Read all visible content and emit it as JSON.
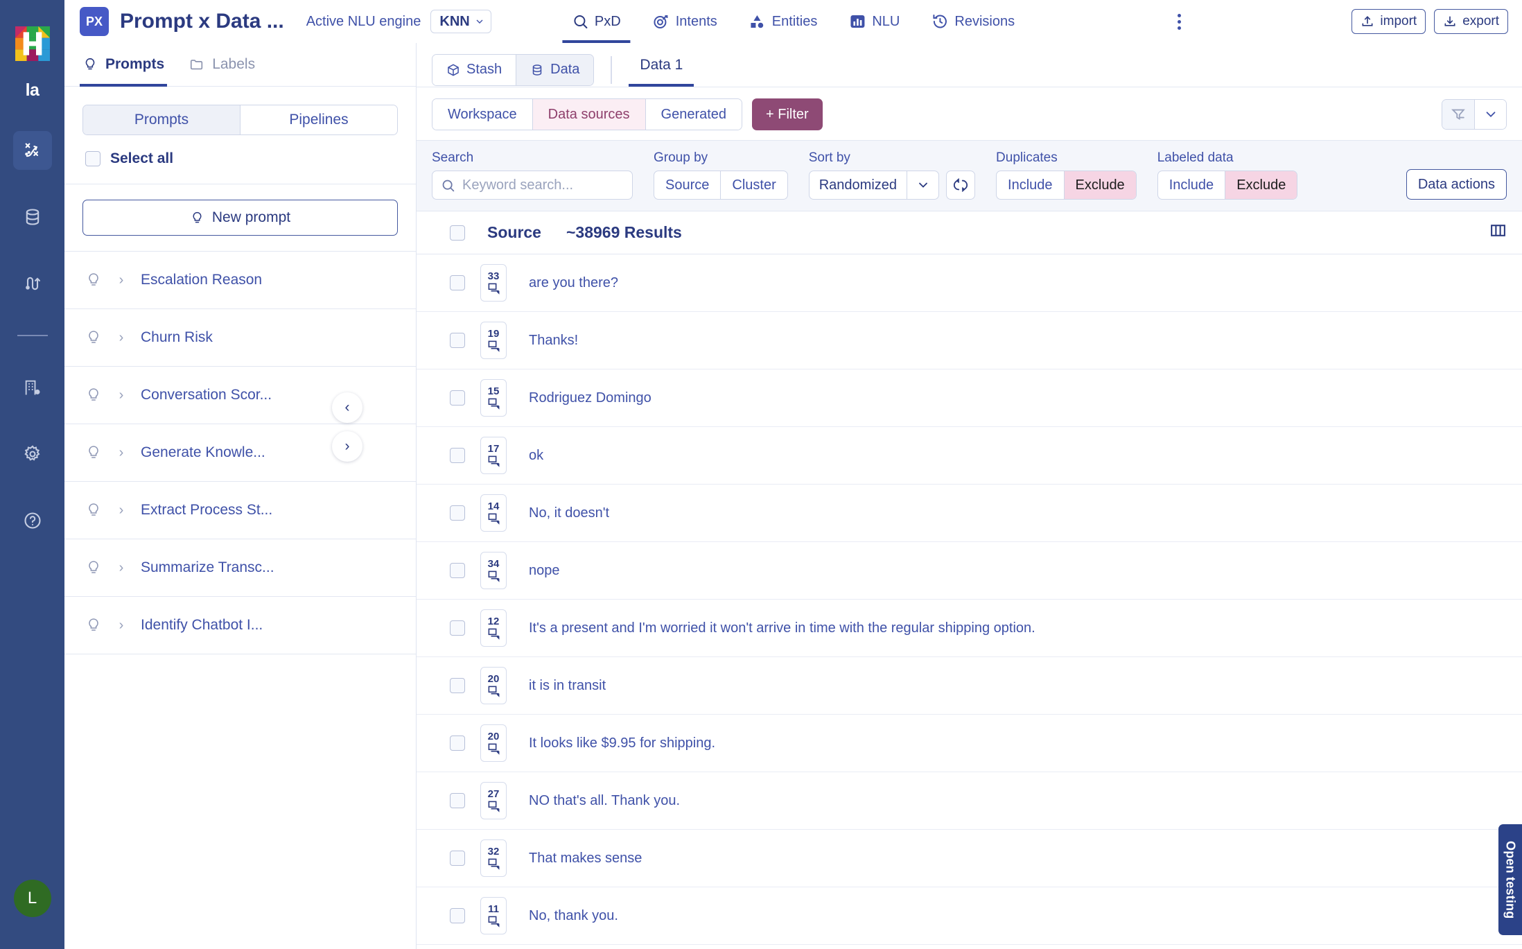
{
  "rail": {
    "wordmark": "la",
    "icons": [
      {
        "name": "strategy-icon",
        "active": true
      },
      {
        "name": "database-icon",
        "active": false
      },
      {
        "name": "flow-branch-icon",
        "active": false
      },
      {
        "name": "building-settings-icon",
        "active": false
      },
      {
        "name": "gear-icon",
        "active": false
      },
      {
        "name": "help-circle-icon",
        "active": false
      }
    ],
    "avatar_initial": "L"
  },
  "topbar": {
    "badge": "PX",
    "title": "Prompt x Data ...",
    "nlu_engine_label": "Active NLU engine",
    "nlu_engine_value": "KNN",
    "nav": [
      {
        "label": "PxD",
        "icon": "search-icon",
        "active": true
      },
      {
        "label": "Intents",
        "icon": "target-icon",
        "active": false
      },
      {
        "label": "Entities",
        "icon": "shapes-icon",
        "active": false
      },
      {
        "label": "NLU",
        "icon": "bar-chart-icon",
        "active": false
      },
      {
        "label": "Revisions",
        "icon": "history-clock-icon",
        "active": false
      }
    ],
    "import_label": "import",
    "export_label": "export"
  },
  "sidebar": {
    "tabs": [
      {
        "label": "Prompts",
        "icon": "bulb-icon",
        "active": true
      },
      {
        "label": "Labels",
        "icon": "folder-icon",
        "active": false
      }
    ],
    "segment": [
      {
        "label": "Prompts",
        "active": true
      },
      {
        "label": "Pipelines",
        "active": false
      }
    ],
    "select_all_label": "Select all",
    "new_prompt_label": "New prompt",
    "prompts": [
      {
        "name": "Escalation Reason"
      },
      {
        "name": "Churn Risk"
      },
      {
        "name": "Conversation Scor..."
      },
      {
        "name": "Generate Knowle..."
      },
      {
        "name": "Extract Process St..."
      },
      {
        "name": "Summarize Transc..."
      },
      {
        "name": "Identify Chatbot I..."
      }
    ]
  },
  "main": {
    "stash_segment": [
      {
        "label": "Stash",
        "icon": "box-icon",
        "active": false
      },
      {
        "label": "Data",
        "icon": "database-icon",
        "active": true
      }
    ],
    "data_tab_label": "Data 1",
    "source_segment": [
      {
        "label": "Workspace",
        "active": false
      },
      {
        "label": "Data sources",
        "active": true
      },
      {
        "label": "Generated",
        "active": false
      }
    ],
    "filter_button_label": "+ Filter",
    "controls": {
      "search_label": "Search",
      "search_value": "",
      "search_placeholder": "Keyword search...",
      "group_by_label": "Group by",
      "group_by_options": [
        {
          "label": "Source",
          "active": false
        },
        {
          "label": "Cluster",
          "active": false
        }
      ],
      "sort_by_label": "Sort by",
      "sort_by_value": "Randomized",
      "duplicates_label": "Duplicates",
      "duplicates_options": [
        {
          "label": "Include",
          "active": false
        },
        {
          "label": "Exclude",
          "active": true
        }
      ],
      "labeled_data_label": "Labeled data",
      "labeled_data_options": [
        {
          "label": "Include",
          "active": false
        },
        {
          "label": "Exclude",
          "active": true
        }
      ],
      "data_actions_label": "Data actions"
    },
    "table": {
      "source_header": "Source",
      "results_header": "~38969  Results",
      "rows": [
        {
          "count": "33",
          "text": "are you there?"
        },
        {
          "count": "19",
          "text": "Thanks!"
        },
        {
          "count": "15",
          "text": "Rodriguez Domingo"
        },
        {
          "count": "17",
          "text": "ok"
        },
        {
          "count": "14",
          "text": "No, it doesn't"
        },
        {
          "count": "34",
          "text": "nope"
        },
        {
          "count": "12",
          "text": "It's a present and I'm worried it won't arrive in time with the regular shipping option."
        },
        {
          "count": "20",
          "text": "it is in transit"
        },
        {
          "count": "20",
          "text": "It looks like $9.95 for shipping."
        },
        {
          "count": "27",
          "text": "NO that's all. Thank you."
        },
        {
          "count": "32",
          "text": "That makes sense"
        },
        {
          "count": "11",
          "text": "No, thank you."
        }
      ]
    }
  },
  "open_testing_label": "Open testing",
  "colors": {
    "rail_bg": "#334b80",
    "accent": "#31469c",
    "filter_purple": "#8e4a75",
    "pink_active": "#f6d5e4",
    "avatar_green": "#2f6b23"
  }
}
